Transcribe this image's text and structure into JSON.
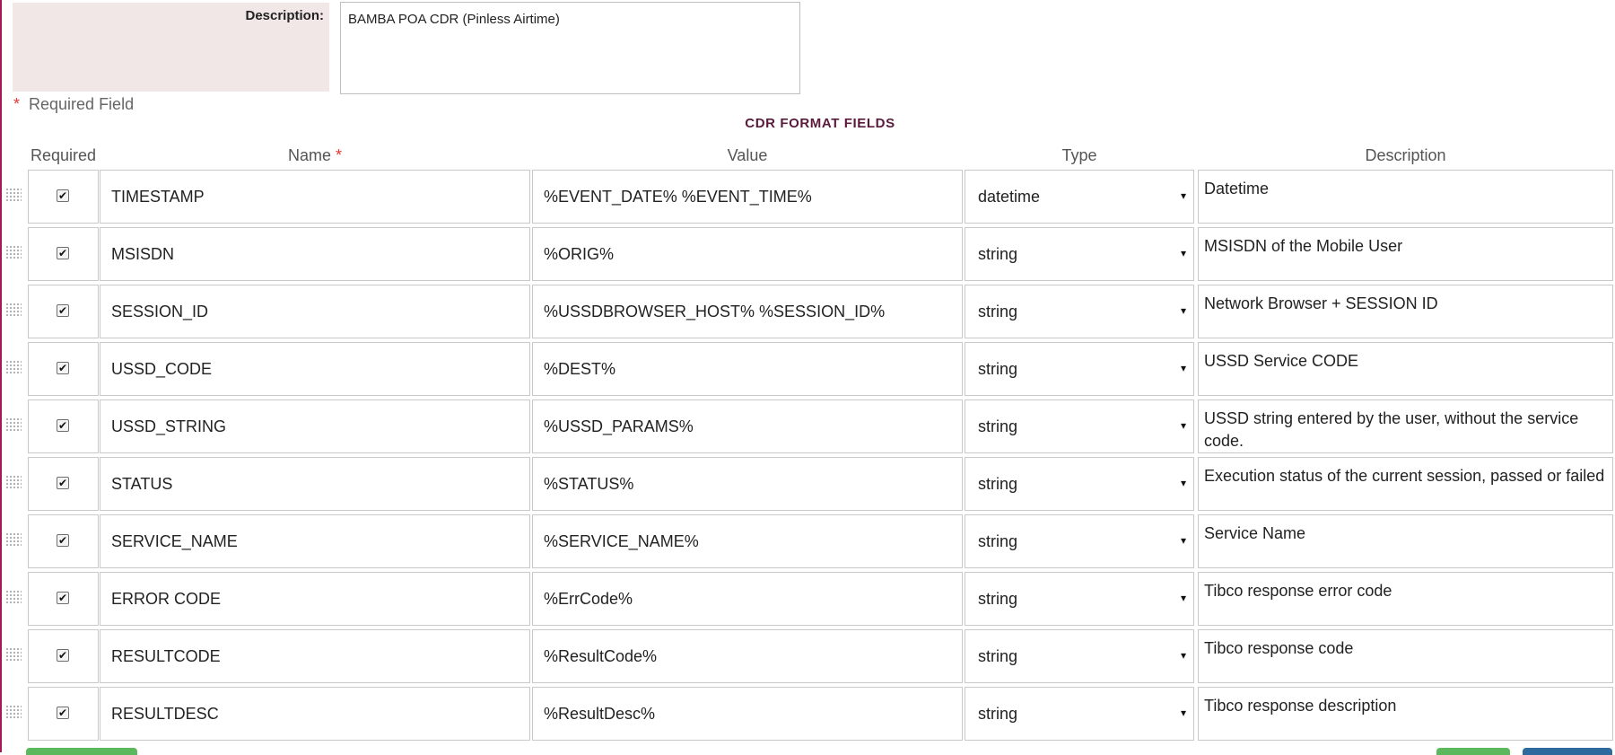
{
  "form": {
    "description_label": "Description:",
    "description_value": "BAMBA POA CDR (Pinless Airtime)",
    "required_star": "*",
    "required_note": "Required Field",
    "section_title": "CDR FORMAT FIELDS"
  },
  "table": {
    "headers": {
      "required": "Required",
      "name": "Name",
      "name_star": "*",
      "value": "Value",
      "type": "Type",
      "description": "Description"
    },
    "rows": [
      {
        "required": true,
        "name": "TIMESTAMP",
        "value": "%EVENT_DATE% %EVENT_TIME%",
        "type": "datetime",
        "description": "Datetime"
      },
      {
        "required": true,
        "name": "MSISDN",
        "value": "%ORIG%",
        "type": "string",
        "description": "MSISDN of the Mobile User"
      },
      {
        "required": true,
        "name": "SESSION_ID",
        "value": "%USSDBROWSER_HOST% %SESSION_ID%",
        "type": "string",
        "description": " Network Browser + SESSION ID"
      },
      {
        "required": true,
        "name": "USSD_CODE",
        "value": "%DEST%",
        "type": "string",
        "description": "USSD Service CODE"
      },
      {
        "required": true,
        "name": "USSD_STRING",
        "value": "%USSD_PARAMS%",
        "type": "string",
        "description": "USSD string entered by the user, without the service code."
      },
      {
        "required": true,
        "name": "STATUS",
        "value": "%STATUS%",
        "type": "string",
        "description": " Execution status of the current session, passed or failed"
      },
      {
        "required": true,
        "name": "SERVICE_NAME",
        "value": "%SERVICE_NAME%",
        "type": "string",
        "description": "Service Name"
      },
      {
        "required": true,
        "name": "ERROR CODE",
        "value": "%ErrCode%",
        "type": "string",
        "description": "Tibco response error code"
      },
      {
        "required": true,
        "name": "RESULTCODE",
        "value": "%ResultCode%",
        "type": "string",
        "description": "Tibco response code"
      },
      {
        "required": true,
        "name": "RESULTDESC",
        "value": "%ResultDesc%",
        "type": "string",
        "description": "Tibco response description"
      }
    ]
  },
  "icons": {
    "drag_handle": "drag-handle-icon",
    "checkbox_checked": "✔",
    "select_caret": "▾"
  },
  "colors": {
    "accent_border": "#a5195a",
    "label_background": "#f2e7e7",
    "section_title": "#5a1a3c",
    "required_star": "#e53935",
    "button_green": "#5cb85c",
    "button_blue": "#2e6a9e"
  }
}
